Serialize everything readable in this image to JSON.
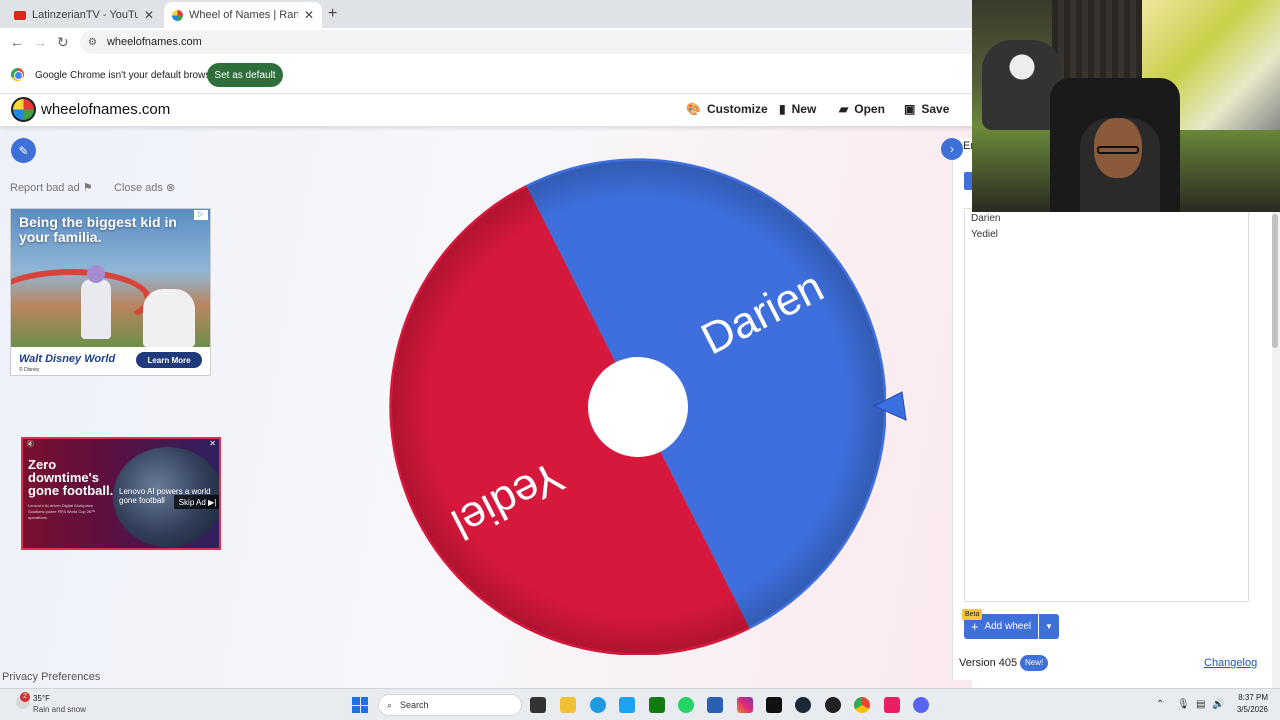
{
  "browser": {
    "tabs": [
      {
        "title": "LatinzerianTV - YouTube",
        "close": "✕"
      },
      {
        "title": "Wheel of Names | Random name",
        "close": "✕"
      }
    ],
    "new_tab": "+",
    "url": "wheelofnames.com",
    "infobar_message": "Google Chrome isn't your default browser",
    "set_default_label": "Set as default"
  },
  "site": {
    "name": "wheelofnames.com",
    "menu": {
      "customize": "Customize",
      "new": "New",
      "open": "Open",
      "save": "Save"
    }
  },
  "ads": {
    "report_label": "Report bad ad",
    "close_label": "Close ads",
    "ad1": {
      "headline": "Being the biggest kid in your familia.",
      "brand": "Walt Disney World",
      "sub": "© Disney",
      "cta": "Learn More",
      "badge": "▷"
    },
    "ad2": {
      "headline": "Zero downtime's gone football.",
      "body": "Lenovo's AI-driven Digital Workplace Solutions power FIFA World Cup 26™ operations.",
      "overlay": "Lenovo AI powers a world gone football",
      "skip": "Skip Ad ▶|",
      "close": "✕",
      "mute": "🔇"
    },
    "privacy_label": "Privacy Preferences"
  },
  "wheel": {
    "entries": [
      "Darien",
      "Yediel"
    ],
    "colors": {
      "Darien": "#3e6fdc",
      "Yediel": "#d6183c"
    }
  },
  "panel": {
    "tab_label": "En",
    "entries": [
      "Darien",
      "Yediel"
    ],
    "beta_label": "Beta",
    "add_wheel_label": "Add wheel",
    "version": "Version 405",
    "new_badge": "New!",
    "changelog_label": "Changelog"
  },
  "taskbar": {
    "weather_temp": "35°F",
    "weather_desc": "Rain and snow",
    "weather_alert": "2",
    "search_label": "Search",
    "time": "8:37 PM",
    "date": "3/5/2026"
  }
}
